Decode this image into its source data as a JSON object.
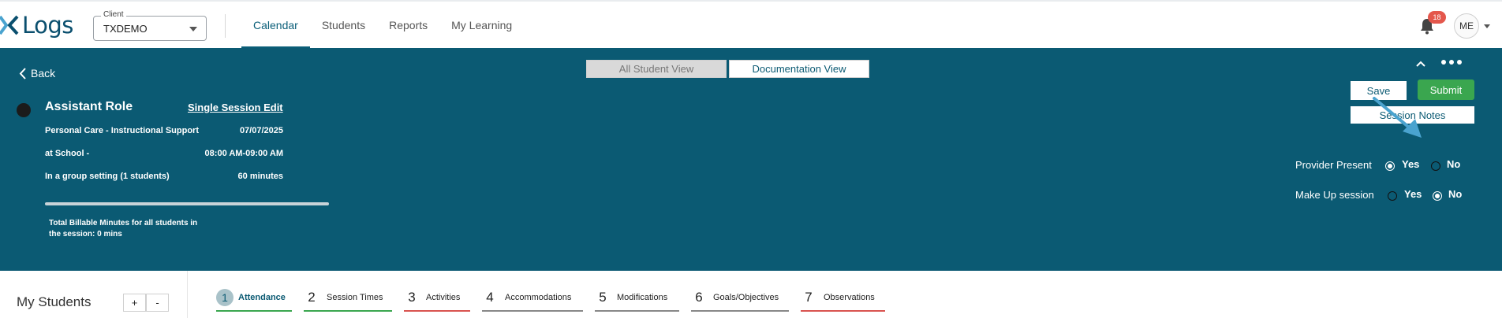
{
  "brand": {
    "name": "Logs"
  },
  "client": {
    "label": "Client",
    "value": "TXDEMO"
  },
  "nav": [
    {
      "label": "Calendar",
      "active": true
    },
    {
      "label": "Students",
      "active": false
    },
    {
      "label": "Reports",
      "active": false
    },
    {
      "label": "My Learning",
      "active": false
    }
  ],
  "notifications": {
    "count": "18",
    "icon": "bell-icon"
  },
  "user": {
    "initials": "ME"
  },
  "session": {
    "back_label": "Back",
    "views": {
      "all_student": "All Student View",
      "documentation": "Documentation View"
    },
    "role": "Assistant Role",
    "edit_link": "Single Session Edit",
    "service": "Personal Care - Instructional Support",
    "date": "07/07/2025",
    "location": "at School -",
    "time": "08:00 AM-09:00 AM",
    "setting": "In a group setting (1 students)",
    "duration": "60 minutes",
    "billable_line1": "Total Billable Minutes for all students in",
    "billable_line2": "the session: 0 mins",
    "actions": {
      "save": "Save",
      "submit": "Submit",
      "notes": "Session Notes"
    },
    "provider_present": {
      "label": "Provider Present",
      "yes": "Yes",
      "no": "No",
      "selected": "Yes"
    },
    "make_up": {
      "label": "Make Up session",
      "yes": "Yes",
      "no": "No",
      "selected": "No"
    }
  },
  "students": {
    "title": "My Students",
    "add": "+",
    "remove": "-"
  },
  "steps": [
    {
      "num": "1",
      "label": "Attendance",
      "bar_color": "#3aa64f",
      "active": true
    },
    {
      "num": "2",
      "label": "Session Times",
      "bar_color": "#3aa64f",
      "active": false
    },
    {
      "num": "3",
      "label": "Activities",
      "bar_color": "#d9534f",
      "active": false
    },
    {
      "num": "4",
      "label": "Accommodations",
      "bar_color": "#888888",
      "active": false
    },
    {
      "num": "5",
      "label": "Modifications",
      "bar_color": "#888888",
      "active": false
    },
    {
      "num": "6",
      "label": "Goals/Objectives",
      "bar_color": "#888888",
      "active": false
    },
    {
      "num": "7",
      "label": "Observations",
      "bar_color": "#d9534f",
      "active": false
    }
  ],
  "colors": {
    "teal": "#0b5a73",
    "green": "#3aa64f",
    "badge": "#e4574c",
    "annotation_arrow": "#4aa3cf"
  }
}
